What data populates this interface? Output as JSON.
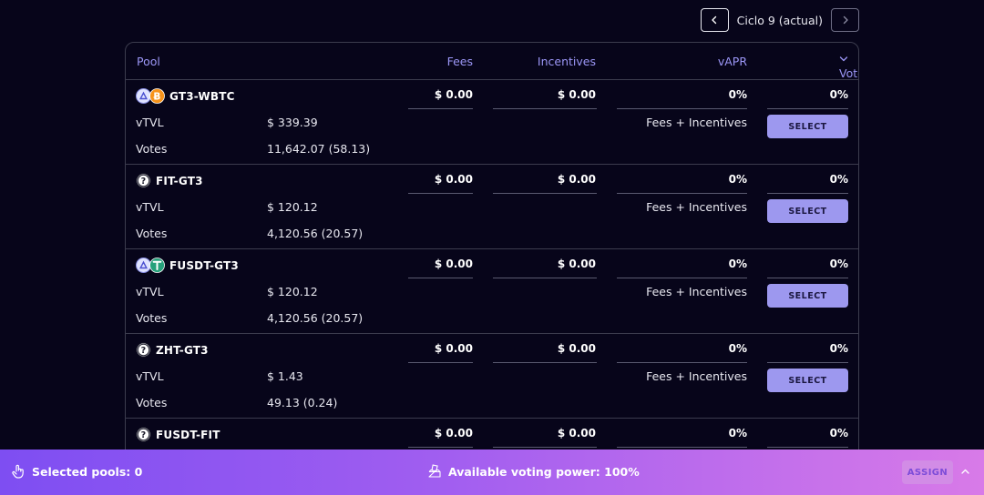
{
  "cycle": {
    "label": "Ciclo 9 (actual)"
  },
  "table": {
    "headers": {
      "pool": "Pool",
      "fees": "Fees",
      "incentives": "Incentives",
      "vapr": "vAPR",
      "vote": "Vote"
    },
    "row_labels": {
      "vtvl": "vTVL",
      "votes": "Votes"
    },
    "select_label": "SELECT",
    "rows": [
      {
        "name": "GT3-WBTC",
        "tokens": [
          "gt3-icon",
          "bitcoin-icon"
        ],
        "fees": "$ 0.00",
        "incentives": "$ 0.00",
        "vapr": "0%",
        "vote": "0%",
        "vtvl": "$ 339.39",
        "votes": "11,642.07 (58.13)",
        "reward": "Fees + Incentives"
      },
      {
        "name": "FIT-GT3",
        "tokens": [
          "unknown-token-icon"
        ],
        "fees": "$ 0.00",
        "incentives": "$ 0.00",
        "vapr": "0%",
        "vote": "0%",
        "vtvl": "$ 120.12",
        "votes": "4,120.56 (20.57)",
        "reward": "Fees + Incentives"
      },
      {
        "name": "FUSDT-GT3",
        "tokens": [
          "gt3-icon",
          "tether-icon"
        ],
        "fees": "$ 0.00",
        "incentives": "$ 0.00",
        "vapr": "0%",
        "vote": "0%",
        "vtvl": "$ 120.12",
        "votes": "4,120.56 (20.57)",
        "reward": "Fees + Incentives"
      },
      {
        "name": "ZHT-GT3",
        "tokens": [
          "unknown-token-icon"
        ],
        "fees": "$ 0.00",
        "incentives": "$ 0.00",
        "vapr": "0%",
        "vote": "0%",
        "vtvl": "$ 1.43",
        "votes": "49.13 (0.24)",
        "reward": "Fees + Incentives"
      },
      {
        "name": "FUSDT-FIT",
        "tokens": [
          "unknown-token-icon"
        ],
        "fees": "$ 0.00",
        "incentives": "$ 0.00",
        "vapr": "0%",
        "vote": "0%"
      }
    ]
  },
  "bottom_bar": {
    "selected_pools": "Selected pools: 0",
    "voting_power": "Available voting power: 100%",
    "assign_label": "ASSIGN"
  }
}
